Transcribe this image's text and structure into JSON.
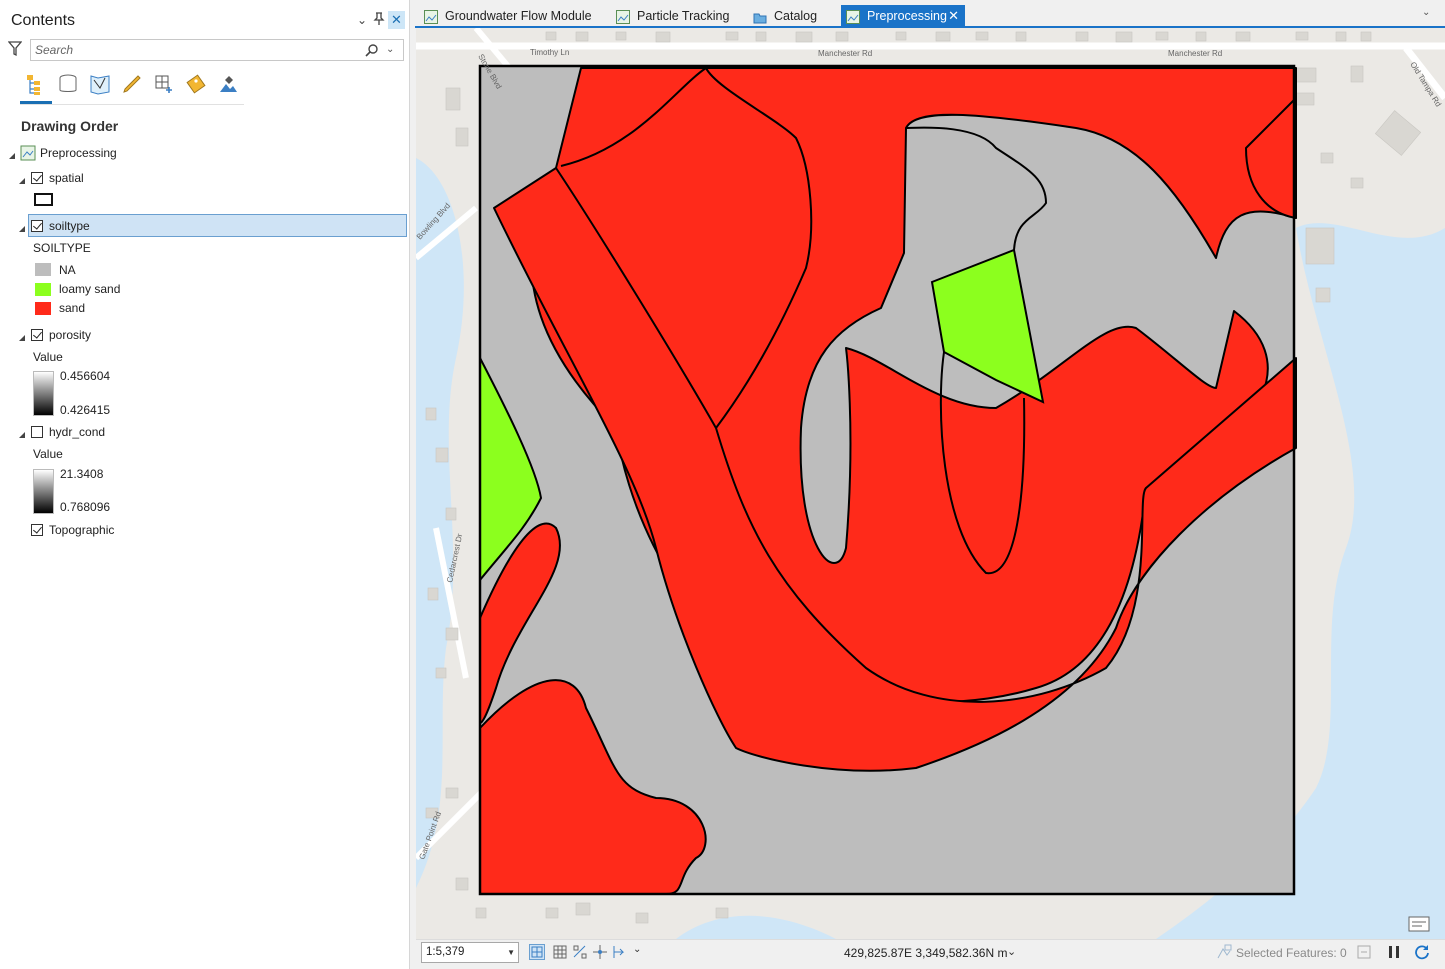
{
  "contents_pane": {
    "title": "Contents",
    "search_placeholder": "Search",
    "section_title": "Drawing Order",
    "map_name": "Preprocessing",
    "layers": [
      {
        "name": "spatial",
        "checked": true
      },
      {
        "name": "soiltype",
        "checked": true,
        "selected": true,
        "legend_title": "SOILTYPE",
        "classes": [
          {
            "label": "NA",
            "color": "#bdbdbd"
          },
          {
            "label": "loamy sand",
            "color": "#8cff1e"
          },
          {
            "label": "sand",
            "color": "#ff2a1a"
          }
        ]
      },
      {
        "name": "porosity",
        "checked": true,
        "legend_title": "Value",
        "max": "0.456604",
        "min": "0.426415"
      },
      {
        "name": "hydr_cond",
        "checked": false,
        "legend_title": "Value",
        "max": "21.3408",
        "min": "0.768096"
      },
      {
        "name": "Topographic",
        "checked": true
      }
    ]
  },
  "tabs": [
    {
      "label": "Groundwater Flow Module",
      "active": false
    },
    {
      "label": "Particle Tracking",
      "active": false
    },
    {
      "label": "Catalog",
      "active": false
    },
    {
      "label": "Preprocessing",
      "active": true
    }
  ],
  "map": {
    "street_labels": [
      "Timothy Ln",
      "Manchester Rd",
      "Manchester Rd",
      "Stone Blvd",
      "Bowling Blvd",
      "Cedarcrest Dr",
      "Gate Point Rd",
      "Old Tampa Rd"
    ]
  },
  "status_bar": {
    "scale": "1:5,379",
    "coordinates": "429,825.87E 3,349,582.36N m",
    "selected_features": "Selected Features: 0"
  },
  "colors": {
    "accent": "#1a73c8",
    "water": "#cfe6f7",
    "na": "#bdbdbd",
    "loamy_sand": "#8cff1e",
    "sand": "#ff2a1a"
  }
}
